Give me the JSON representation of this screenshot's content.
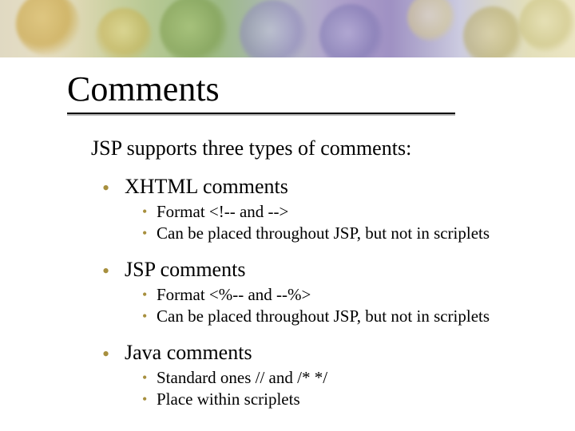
{
  "title": "Comments",
  "lead": "JSP supports three types of comments:",
  "sections": [
    {
      "heading": "XHTML comments",
      "points": [
        "Format <!-- and -->",
        "Can be placed throughout JSP, but not in scriplets"
      ]
    },
    {
      "heading": "JSP comments",
      "points": [
        "Format <%-- and --%>",
        "Can be placed throughout JSP, but not in scriplets"
      ]
    },
    {
      "heading": "Java comments",
      "points": [
        "Standard ones //   and /*     */",
        "Place within scriplets"
      ]
    }
  ]
}
